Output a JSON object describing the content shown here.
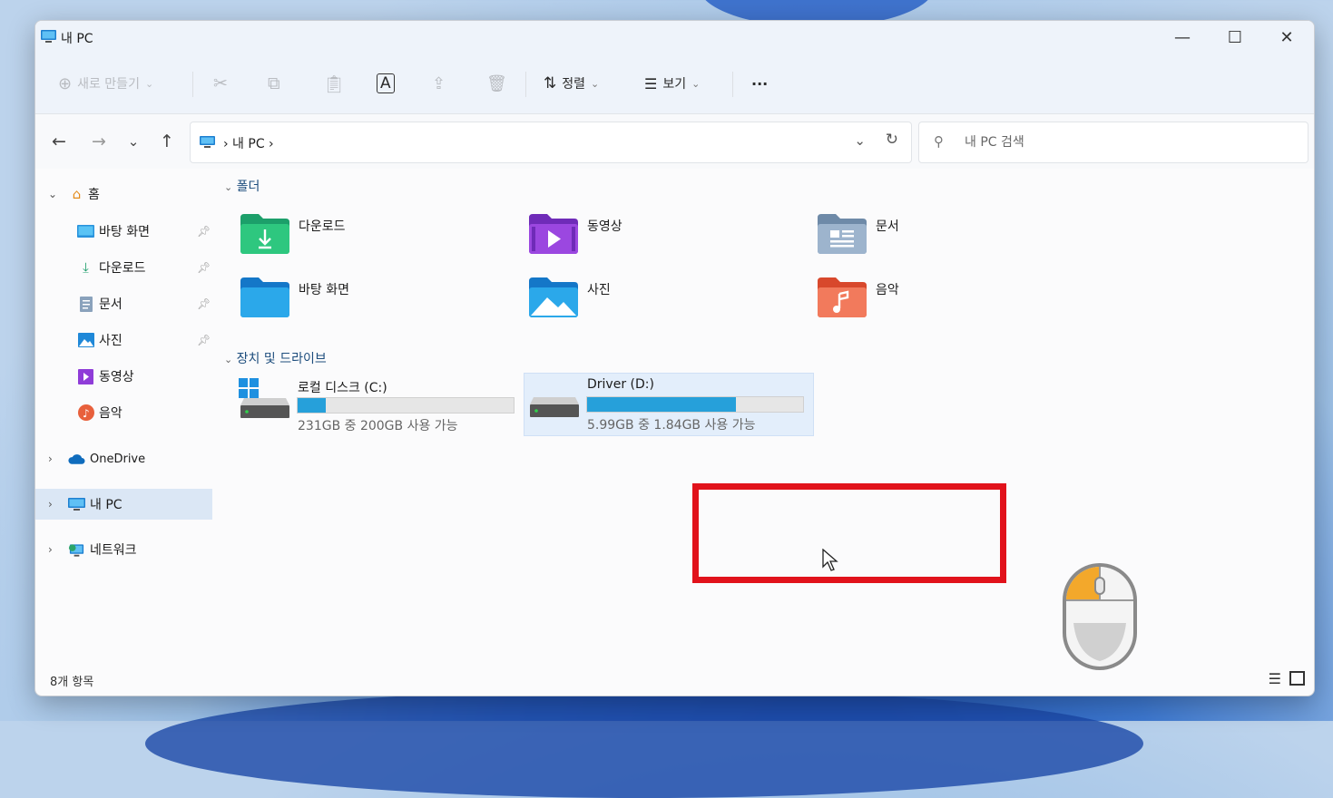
{
  "window": {
    "title": "내 PC",
    "controls": {
      "minimize": "—",
      "maximize": "☐",
      "close": "✕"
    }
  },
  "toolbar": {
    "new_label": "새로 만들기",
    "sort_label": "정렬",
    "view_label": "보기",
    "more_label": "···"
  },
  "nav": {
    "back": "←",
    "forward": "→",
    "recent": "⌄",
    "up": "↑",
    "breadcrumb": "›  내 PC  ›",
    "search_placeholder": "내 PC 검색"
  },
  "sidebar": {
    "home": "홈",
    "items": [
      {
        "label": "바탕 화면",
        "icon": "desktop-icon",
        "pinned": true
      },
      {
        "label": "다운로드",
        "icon": "download-icon",
        "pinned": true
      },
      {
        "label": "문서",
        "icon": "document-icon",
        "pinned": true
      },
      {
        "label": "사진",
        "icon": "pictures-icon",
        "pinned": true
      },
      {
        "label": "동영상",
        "icon": "videos-icon",
        "pinned": false
      },
      {
        "label": "음악",
        "icon": "music-icon",
        "pinned": false
      }
    ],
    "onedrive": "OneDrive",
    "thispc": "내 PC",
    "network": "네트워크"
  },
  "groups": {
    "folders_header": "폴더",
    "drives_header": "장치 및 드라이브"
  },
  "folders": [
    {
      "label": "다운로드",
      "icon": "download-folder-icon"
    },
    {
      "label": "동영상",
      "icon": "videos-folder-icon"
    },
    {
      "label": "문서",
      "icon": "documents-folder-icon"
    },
    {
      "label": "바탕 화면",
      "icon": "desktop-folder-icon"
    },
    {
      "label": "사진",
      "icon": "pictures-folder-icon"
    },
    {
      "label": "음악",
      "icon": "music-folder-icon"
    }
  ],
  "drives": [
    {
      "name": "로컬 디스크 (C:)",
      "space": "231GB 중 200GB 사용 가능",
      "used_fraction": 0.13
    },
    {
      "name": "Driver (D:)",
      "space": "5.99GB 중 1.84GB 사용 가능",
      "used_fraction": 0.69
    }
  ],
  "status": {
    "item_count": "8개 항목"
  },
  "colors": {
    "accent": "#26a0da",
    "highlight_border": "#e1121b",
    "selection": "#dbe7f5"
  }
}
